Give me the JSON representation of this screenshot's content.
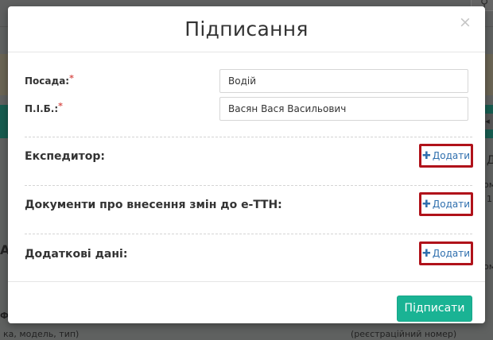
{
  "background": {
    "left_letter_a": "А",
    "left_letter_f": "Ф",
    "right_letter_d": "Д",
    "right_fragment_om": "ом",
    "right_fragment_1": "1",
    "right_fragment_pm": "ом",
    "bottom_left_hint": "ка, модель, тип)",
    "bottom_right_hint": "(реєстраційний номер)"
  },
  "modal": {
    "title": "Підписання",
    "close_symbol": "×",
    "fields": [
      {
        "label": "Посада:",
        "required_mark": "*",
        "value": "Водій"
      },
      {
        "label": "П.І.Б.:",
        "required_mark": "*",
        "value": "Васян Вася Васильович"
      }
    ],
    "sections": [
      {
        "label": "Експедитор:",
        "add_label": "Додати"
      },
      {
        "label": "Документи про внесення змін до е-ТТН:",
        "add_label": "Додати"
      },
      {
        "label": "Додаткові дані:",
        "add_label": "Додати"
      }
    ],
    "submit_label": "Підписати"
  },
  "colors": {
    "primary": "#1ab394",
    "link": "#2f6fae",
    "highlight_border": "#b0121a",
    "required": "#d9534f"
  }
}
